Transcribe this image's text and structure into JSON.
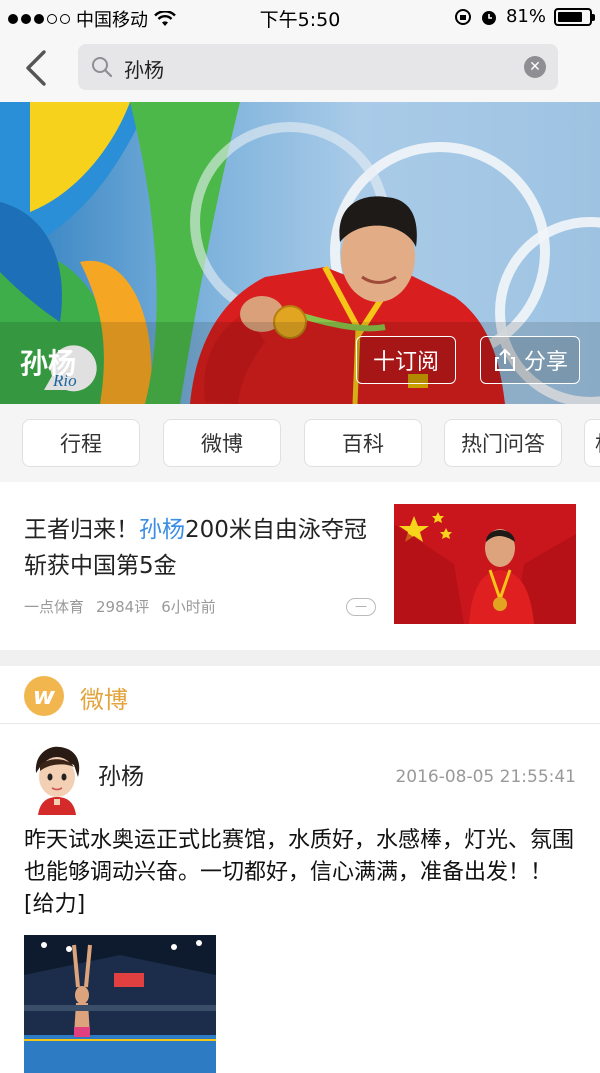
{
  "status_bar": {
    "carrier": "中国移动",
    "time": "下午5:50",
    "battery": "81%",
    "battery_level": 0.81
  },
  "nav": {
    "search_value": "孙杨",
    "icons": [
      "back-chevron-icon",
      "search-icon",
      "clear-icon"
    ]
  },
  "banner": {
    "name": "孙杨",
    "subscribe_label": "十订阅",
    "share_label": "分享"
  },
  "tags": [
    "行程",
    "微博",
    "百科",
    "热门问答",
    "相"
  ],
  "news": {
    "title_prefix": "王者归来！",
    "title_highlight": "孙杨",
    "title_rest": "200米自由泳夺冠 斩获中国第5金",
    "source": "一点体育",
    "comments": "2984评",
    "time": "6小时前",
    "dislike": "—"
  },
  "weibo": {
    "section_label": "微博",
    "logo_letter": "w",
    "post": {
      "user": "孙杨",
      "timestamp": "2016-08-05 21:55:41",
      "text": "昨天试水奥运正式比赛馆，水质好，水感棒，灯光、氛围也能够调动兴奋。一切都好，信心满满，准备出发！！[给力]"
    }
  },
  "colors": {
    "accent_blue": "#3a8ee6",
    "weibo_orange": "#e3a43c",
    "flag_red": "#c41418"
  }
}
